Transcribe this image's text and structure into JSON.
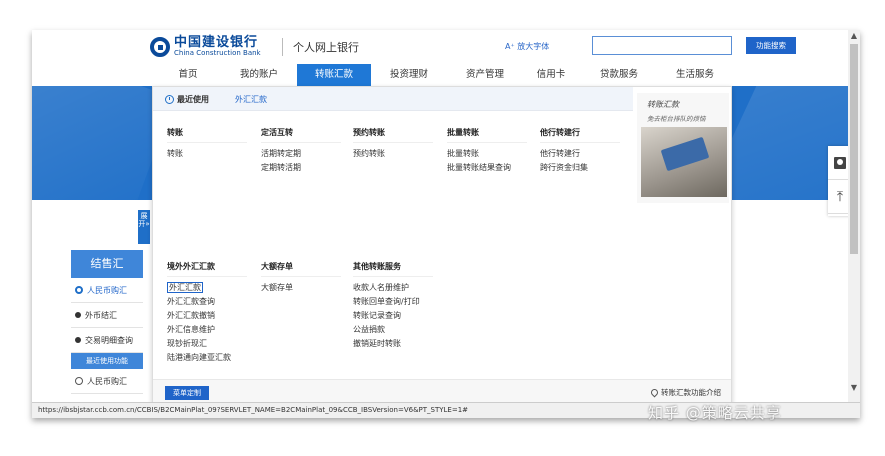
{
  "header": {
    "logo_cn": "中国建设银行",
    "logo_en": "China Construction Bank",
    "portal": "个人网上银行",
    "font_button": "A⁺ 放大字体",
    "search_placeholder": "",
    "search_button": "功能搜索"
  },
  "nav": {
    "items": [
      "首页",
      "我的账户",
      "转账汇款",
      "投资理财",
      "资产管理",
      "信用卡",
      "贷款服务",
      "生活服务"
    ],
    "active": "转账汇款"
  },
  "left_panel": {
    "expand_label": "展开»",
    "title": "结售汇",
    "items": [
      "人民币购汇",
      "外币结汇",
      "交易明细查询"
    ],
    "recent_label": "最近使用功能",
    "recent_items": [
      "人民币购汇"
    ]
  },
  "dropdown": {
    "recent_label": "最近使用",
    "recent_link": "外汇汇款",
    "columns_row1": [
      {
        "title": "转账",
        "links": [
          "转账"
        ]
      },
      {
        "title": "定活互转",
        "links": [
          "活期转定期",
          "定期转活期"
        ]
      },
      {
        "title": "预约转账",
        "links": [
          "预约转账"
        ]
      },
      {
        "title": "批量转账",
        "links": [
          "批量转账",
          "批量转账结果查询"
        ]
      },
      {
        "title": "他行转建行",
        "links": [
          "他行转建行",
          "跨行资金归集"
        ]
      }
    ],
    "columns_row2": [
      {
        "title": "境外外汇汇款",
        "links": [
          "外汇汇款",
          "外汇汇款查询",
          "外汇汇款撤销",
          "外汇信息维护",
          "现钞折现汇",
          "陆港通向建亚汇款"
        ]
      },
      {
        "title": "大额存单",
        "links": [
          "大额存单"
        ]
      },
      {
        "title": "其他转账服务",
        "links": [
          "收款人名册维护",
          "转账回单查询/打印",
          "转账记录查询",
          "公益捐款",
          "撤销延时转账"
        ]
      }
    ],
    "promo_title": "转账汇款",
    "promo_subtitle": "免去柜台排队的烦恼",
    "menu_button": "菜单定制",
    "intro_link": "转账汇款功能介绍"
  },
  "status_url": "https://ibsbjstar.ccb.com.cn/CCBIS/B2CMainPlat_09?SERVLET_NAME=B2CMainPlat_09&CCB_IBSVersion=V6&PT_STYLE=1#",
  "watermark": "知乎 @策略云共享"
}
